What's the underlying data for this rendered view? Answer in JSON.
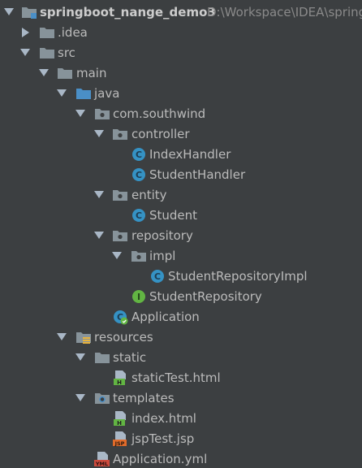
{
  "project": {
    "name": "springboot_nange_demo3",
    "path": "D:\\Workspace\\IDEA\\spring"
  },
  "nodes": [
    {
      "label": "springboot_nange_demo3",
      "icon": "module-folder-icon",
      "expanded": true
    },
    {
      "label": ".idea",
      "icon": "folder-icon",
      "expanded": false
    },
    {
      "label": "src",
      "icon": "folder-icon",
      "expanded": true
    },
    {
      "label": "main",
      "icon": "folder-icon",
      "expanded": true
    },
    {
      "label": "java",
      "icon": "source-root-folder-icon",
      "expanded": true
    },
    {
      "label": "com.southwind",
      "icon": "package-icon",
      "expanded": true
    },
    {
      "label": "controller",
      "icon": "package-icon",
      "expanded": true
    },
    {
      "label": "IndexHandler",
      "icon": "class-icon"
    },
    {
      "label": "StudentHandler",
      "icon": "class-icon"
    },
    {
      "label": "entity",
      "icon": "package-icon",
      "expanded": true
    },
    {
      "label": "Student",
      "icon": "class-icon"
    },
    {
      "label": "repository",
      "icon": "package-icon",
      "expanded": true
    },
    {
      "label": "impl",
      "icon": "package-icon",
      "expanded": true
    },
    {
      "label": "StudentRepositoryImpl",
      "icon": "class-icon"
    },
    {
      "label": "StudentRepository",
      "icon": "interface-icon"
    },
    {
      "label": "Application",
      "icon": "spring-boot-app-icon"
    },
    {
      "label": "resources",
      "icon": "resources-root-folder-icon",
      "expanded": true
    },
    {
      "label": "static",
      "icon": "folder-icon",
      "expanded": true
    },
    {
      "label": "staticTest.html",
      "icon": "html-file-icon"
    },
    {
      "label": "templates",
      "icon": "templates-folder-icon",
      "expanded": true
    },
    {
      "label": "index.html",
      "icon": "html-file-icon"
    },
    {
      "label": "jspTest.jsp",
      "icon": "jsp-file-icon"
    },
    {
      "label": "Application.yml",
      "icon": "yml-file-icon"
    }
  ],
  "colors": {
    "background": "#3c3f41",
    "text": "#bbbbbb",
    "folder": "#87939a",
    "source_root": "#4a8fc7",
    "class_icon": "#3592c4",
    "interface_icon": "#62b543",
    "html_icon": "#62b543",
    "jsp_icon": "#e16b2a",
    "yml_icon": "#cc4a3c"
  }
}
